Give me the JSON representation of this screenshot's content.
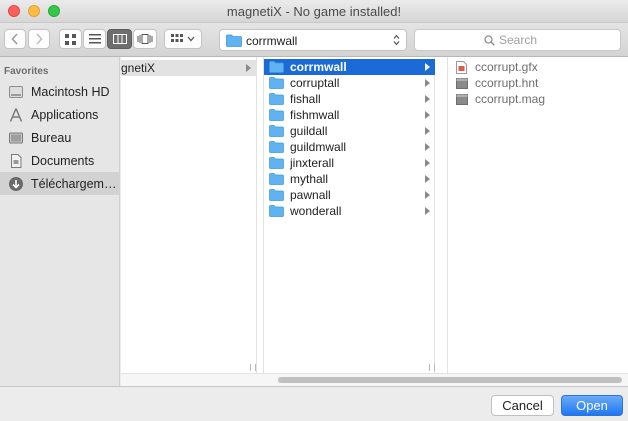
{
  "window": {
    "title": "magnetiX - No game installed!"
  },
  "toolbar": {
    "path": "corrmwall",
    "search_placeholder": "Search"
  },
  "sidebar": {
    "heading": "Favorites",
    "items": [
      {
        "label": "Macintosh HD",
        "icon": "hard-drive-icon"
      },
      {
        "label": "Applications",
        "icon": "applications-icon"
      },
      {
        "label": "Bureau",
        "icon": "desktop-icon"
      },
      {
        "label": "Documents",
        "icon": "documents-icon"
      },
      {
        "label": "Téléchargem…",
        "icon": "downloads-icon",
        "selected": true
      }
    ]
  },
  "columns": {
    "col1": {
      "items": [
        "gnetiX"
      ]
    },
    "col2": {
      "items": [
        "corrmwall",
        "corruptall",
        "fishall",
        "fishmwall",
        "guildall",
        "guildmwall",
        "jinxterall",
        "mythall",
        "pawnall",
        "wonderall"
      ],
      "selected": "corrmwall"
    },
    "col3": {
      "items": [
        "ccorrupt.gfx",
        "ccorrupt.hnt",
        "ccorrupt.mag"
      ]
    }
  },
  "buttons": {
    "cancel": "Cancel",
    "open": "Open"
  },
  "colors": {
    "selection": "#1a6bd8",
    "folder": "#5fb3f0",
    "primary_button": "#1f78f0"
  }
}
